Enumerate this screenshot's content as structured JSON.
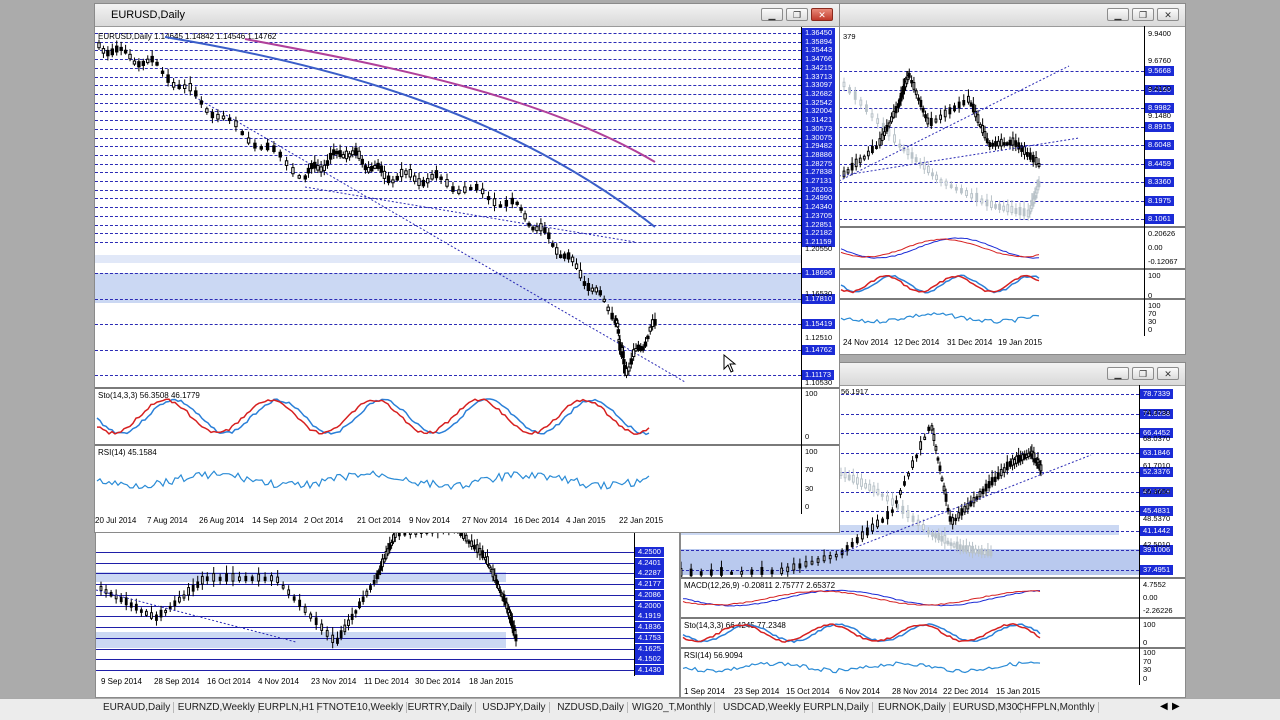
{
  "windows": {
    "eurusd": {
      "title": "EURUSD,Daily",
      "header": "EURUSD,Daily  1.14645 1.14842 1.14546 1.14762",
      "price_levels": [
        "1.36450",
        "1.35894",
        "1.35443",
        "1.34766",
        "1.34215",
        "1.33713",
        "1.33097",
        "1.32682",
        "1.32542",
        "1.32004",
        "1.31421",
        "1.30573",
        "1.30075",
        "1.29482",
        "1.28886",
        "1.28275",
        "1.27838",
        "1.27131",
        "1.26203",
        "1.24990",
        "1.24340",
        "1.23705",
        "1.22851",
        "1.22182",
        "1.21159"
      ],
      "lower_levels": [
        "1.18696",
        "1.17810",
        "1.15419",
        "1.14762",
        "1.11173"
      ],
      "axis_ticks": [
        "1.20550",
        "1.16530",
        "1.12510",
        "1.10530"
      ],
      "stoch_label": "Sto(14,3,3) 56.3508 46.1779",
      "stoch_ticks": [
        "100",
        "0"
      ],
      "rsi_label": "RSI(14) 45.1584",
      "rsi_ticks": [
        "100",
        "70",
        "30",
        "0"
      ],
      "dates": [
        "20 Jul 2014",
        "7 Aug 2014",
        "26 Aug 2014",
        "14 Sep 2014",
        "2 Oct 2014",
        "21 Oct 2014",
        "9 Nov 2014",
        "27 Nov 2014",
        "16 Dec 2014",
        "4 Jan 2015",
        "22 Jan 2015"
      ]
    },
    "top_right": {
      "header_value": "379",
      "ticks": [
        "9.9400",
        "9.6760",
        "9.4120",
        "9.1480"
      ],
      "levels": [
        "9.5668",
        "9.2160",
        "8.9982",
        "8.8915",
        "8.6048",
        "8.4459",
        "8.3360",
        "8.1975",
        "8.1061"
      ],
      "macd_ticks": [
        "0.20626",
        "0.00",
        "-0.12067"
      ],
      "stoch_ticks": [
        "100",
        "0"
      ],
      "rsi_ticks": [
        "100",
        "70",
        "30",
        "0"
      ],
      "dates": [
        "24 Nov 2014",
        "12 Dec 2014",
        "31 Dec 2014",
        "19 Jan 2015"
      ]
    },
    "bottom_right": {
      "header_value": "56.1917",
      "ticks": [
        "74.3730",
        "68.0370",
        "61.7010",
        "55.3650",
        "48.5370",
        "42.5010"
      ],
      "levels": [
        "78.7339",
        "71.6238",
        "66.4452",
        "63.1846",
        "52.3376",
        "47.7759",
        "45.4831",
        "41.1442",
        "39.1006",
        "37.4951"
      ],
      "macd_label": "MACD(12,26,9) -0.20811 2.75777 2.65372",
      "macd_ticks": [
        "4.7552",
        "0.00",
        "-2.26226"
      ],
      "stoch_label": "Sto(14,3,3) 66.4245 77.2348",
      "stoch_ticks": [
        "100",
        "0"
      ],
      "rsi_label": "RSI(14) 56.9094",
      "rsi_ticks": [
        "100",
        "70",
        "30",
        "0"
      ],
      "dates": [
        "1 Sep 2014",
        "23 Sep 2014",
        "15 Oct 2014",
        "6 Nov 2014",
        "28 Nov 2014",
        "22 Dec 2014",
        "15 Jan 2015"
      ]
    },
    "bottom_left": {
      "levels": [
        "4.2500",
        "4.2401",
        "4.2287",
        "4.2177",
        "4.2086",
        "4.2000",
        "4.1919",
        "4.1836",
        "4.1753",
        "4.1625",
        "4.1502",
        "4.1430"
      ],
      "dates": [
        "9 Sep 2014",
        "28 Sep 2014",
        "16 Oct 2014",
        "4 Nov 2014",
        "23 Nov 2014",
        "11 Dec 2014",
        "30 Dec 2014",
        "18 Jan 2015"
      ]
    }
  },
  "tabs": [
    "EURAUD,Daily",
    "EURNZD,Weekly",
    "EURPLN,H1",
    "FTNOTE10,Weekly",
    "EURTRY,Daily",
    "USDJPY,Daily",
    "NZDUSD,Daily",
    "WIG20_T,Monthly",
    "USDCAD,Weekly",
    "EURPLN,Daily",
    "EURNOK,Daily",
    "EURUSD,M30",
    "CHFPLN,Monthly"
  ],
  "colors": {
    "accent": "#1b2bd6",
    "stoch_main": "#2a7fd8",
    "stoch_signal": "#d62020",
    "rsi": "#2a8bd6",
    "ma_blue": "#3a5ec8",
    "ma_magenta": "#b0409a",
    "candle": "#000000"
  }
}
